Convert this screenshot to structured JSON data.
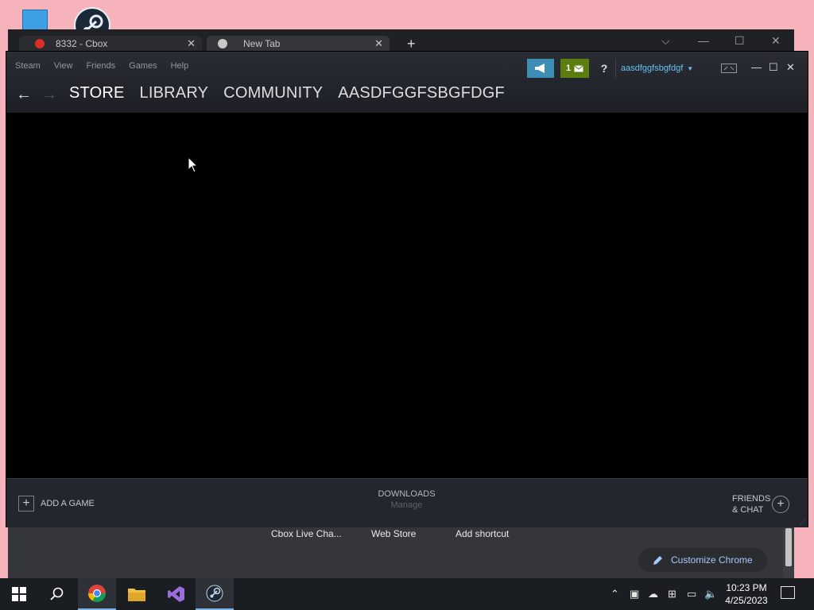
{
  "desktop": {
    "icons": [
      "this-pc-icon",
      "steam-desktop-icon"
    ]
  },
  "chrome": {
    "tabs": [
      {
        "label": "8332 - Cbox"
      },
      {
        "label": "New Tab"
      }
    ],
    "new_tab": "+",
    "controls": {
      "dropdown": "⌵",
      "minimize": "—",
      "maximize": "☐",
      "close": "✕"
    },
    "shortcuts": [
      "Cbox Live Cha...",
      "Web Store",
      "Add shortcut"
    ],
    "customize_label": "Customize Chrome"
  },
  "steam": {
    "menu": [
      "Steam",
      "View",
      "Friends",
      "Games",
      "Help"
    ],
    "nav": {
      "back": "←",
      "forward": "→"
    },
    "tabs": [
      "STORE",
      "LIBRARY",
      "COMMUNITY",
      "AASDFGGFSBGFDGF"
    ],
    "notification_count": "1",
    "help": "?",
    "account": "aasdfggfsbgfdgf",
    "window_controls": {
      "minimize": "—",
      "maximize": "☐",
      "close": "✕"
    },
    "footer": {
      "add_game": "ADD A GAME",
      "downloads_title": "DOWNLOADS",
      "downloads_sub": "Manage",
      "friends_line1": "FRIENDS",
      "friends_line2": "& CHAT"
    }
  },
  "taskbar": {
    "time": "10:23 PM",
    "date": "4/25/2023",
    "apps": [
      "start-button",
      "search-button",
      "chrome-app",
      "file-explorer-app",
      "visual-studio-app",
      "steam-app"
    ]
  },
  "colors": {
    "desktop_bg": "#f7b3bb",
    "steam_accent": "#67c1f5",
    "notif_green": "#5c7e10",
    "announce_blue": "#3e8db5"
  }
}
